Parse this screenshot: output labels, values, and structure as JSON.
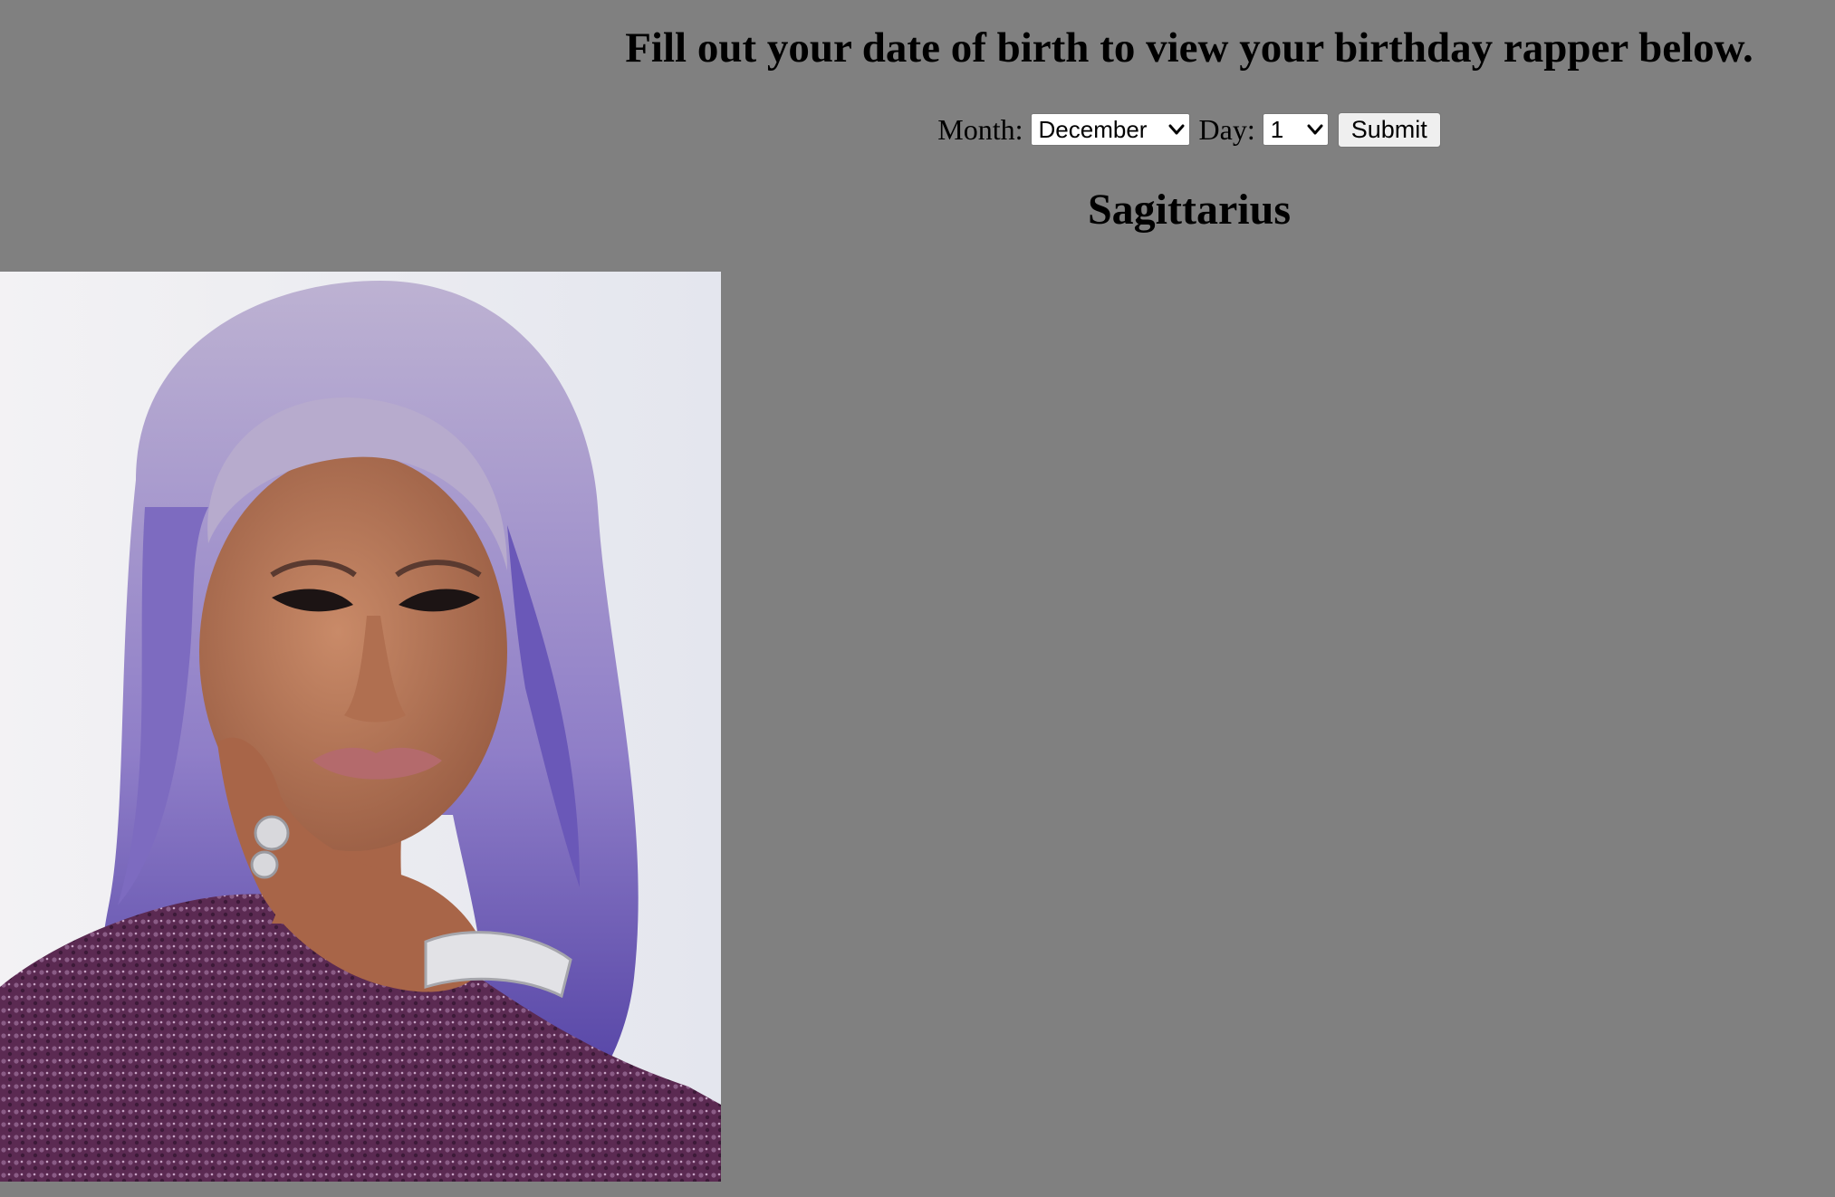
{
  "page": {
    "background_color": "#808080",
    "title": "Fill out your date of birth to view your birthday rapper below."
  },
  "form": {
    "month_label": "Month:",
    "month_selected": "December",
    "day_label": "Day:",
    "day_selected": "1",
    "submit_label": "Submit"
  },
  "result": {
    "zodiac_sign": "Sagittarius",
    "image_icon": "rapper-photo"
  }
}
